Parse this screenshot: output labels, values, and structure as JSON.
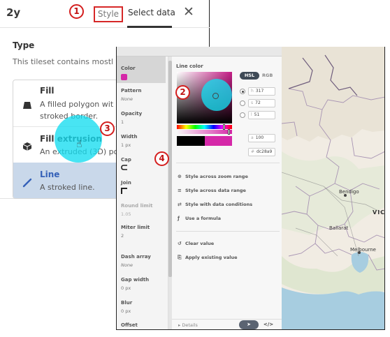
{
  "tileset_panel": {
    "title": "2y",
    "tabs": [
      {
        "label": "Style"
      },
      {
        "label": "Select data"
      }
    ],
    "close_glyph": "✕",
    "section_title": "Type",
    "description": "This tileset contains mostl",
    "options": [
      {
        "icon": "polygon-fill-icon",
        "title": "Fill",
        "desc_line1": "A filled polygon wit",
        "desc_line2": "stroked border."
      },
      {
        "icon": "cube-icon",
        "title": "Fill extrusion",
        "desc_line1": "An extruded (3D) po"
      },
      {
        "icon": "line-icon",
        "title": "Line",
        "desc_line1": "A stroked line.",
        "selected": true
      }
    ]
  },
  "style_panel": {
    "properties": [
      {
        "label": "Color",
        "swatch": "#d528a8"
      },
      {
        "label": "Pattern",
        "value": "None"
      },
      {
        "label": "Opacity",
        "value": "1"
      },
      {
        "label": "Width",
        "value": "1 px"
      },
      {
        "label": "Cap",
        "icon": "cap-round-icon"
      },
      {
        "label": "Join",
        "icon": "join-miter-icon"
      },
      {
        "label": "Round limit",
        "value": "1.05",
        "disabled": true
      },
      {
        "label": "Miter limit",
        "value": "2"
      },
      {
        "label": "Dash array",
        "value": "None"
      },
      {
        "label": "Gap width",
        "value": "0 px"
      },
      {
        "label": "Blur",
        "value": "0 px"
      },
      {
        "label": "Offset"
      }
    ],
    "line_color": {
      "label": "Line color",
      "modes": [
        "HSL",
        "RGB"
      ],
      "active_mode": "HSL",
      "components": [
        {
          "key": "h",
          "value": "317"
        },
        {
          "key": "s",
          "value": "72"
        },
        {
          "key": "l",
          "value": "51"
        }
      ],
      "alpha": {
        "key": "a",
        "value": "100"
      },
      "hex": {
        "key": "#",
        "value": "dc28a9"
      },
      "previous_color": "#000000",
      "current_color": "#d528a8"
    },
    "actions": [
      {
        "icon": "zoom-range-icon",
        "label": "Style across zoom range"
      },
      {
        "icon": "data-range-icon",
        "label": "Style across data range"
      },
      {
        "icon": "data-conditions-icon",
        "label": "Style with data conditions"
      },
      {
        "icon": "formula-icon",
        "label": "Use a formula"
      }
    ],
    "secondary_actions": [
      {
        "icon": "clear-icon",
        "label": "Clear value"
      },
      {
        "icon": "apply-existing-icon",
        "label": "Apply existing value"
      }
    ],
    "footer": {
      "details": "▸ Details",
      "code_glyph": "</>"
    }
  },
  "map": {
    "labels": [
      {
        "text": "Bendigo"
      },
      {
        "text": "VICT"
      },
      {
        "text": "Ballarat"
      },
      {
        "text": "Melbourne"
      }
    ]
  },
  "markers": [
    {
      "label": "1"
    },
    {
      "label": "2"
    },
    {
      "label": "3"
    },
    {
      "label": "4"
    }
  ],
  "colors": {
    "accent_red": "#d41e1e",
    "highlight_cyan": "#14dcf0",
    "line_color": "#d528a8",
    "selected_row": "#c9d8ea"
  }
}
